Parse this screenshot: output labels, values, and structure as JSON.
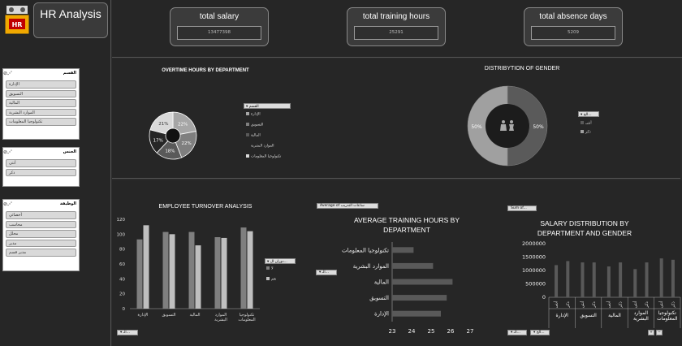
{
  "app": {
    "title": "HR Analysis",
    "logo_text": "HR"
  },
  "kpis": [
    {
      "label": "total salary",
      "value": "13477398"
    },
    {
      "label": "total training hours",
      "value": "25291"
    },
    {
      "label": "total absence days",
      "value": "5209"
    }
  ],
  "slicers": [
    {
      "title": "القسم",
      "items": [
        "الإدارة",
        "التسويق",
        "المالية",
        "الموارد البشرية",
        "تكنولوجيا المعلومات"
      ]
    },
    {
      "title": "الجنس",
      "items": [
        "أنثى",
        "ذكر"
      ]
    },
    {
      "title": "الوظيفة",
      "items": [
        "أخصائي",
        "محاسب",
        "محلل",
        "مدير",
        "مدير قسم"
      ]
    }
  ],
  "overtime": {
    "title": "OVERTIME HOURS BY DEPARTMENT",
    "legend_head": "القسم",
    "legend": [
      "الإدارة",
      "التسويق",
      "المالية",
      "الموارد البشرية",
      "تكنولوجيا المعلومات"
    ],
    "colors": [
      "#a6a6a6",
      "#7f7f7f",
      "#595959",
      "#262626",
      "#d9d9d9"
    ],
    "chart_data": {
      "type": "pie",
      "categories": [
        "الإدارة",
        "التسويق",
        "المالية",
        "الموارد البشرية",
        "تكنولوجيا المعلومات"
      ],
      "values": [
        22,
        22,
        18,
        17,
        21
      ],
      "labels": [
        "22%",
        "22%",
        "18%",
        "17%",
        "21%"
      ]
    }
  },
  "gender": {
    "title": "DISTRIBYTION OF GENDER",
    "legend_head": "الج...",
    "legend": [
      "أنثى",
      "ذكر"
    ],
    "colors": [
      "#5a5a5a",
      "#a0a0a0"
    ],
    "chart_data": {
      "type": "pie",
      "categories": [
        "أنثى",
        "ذكر"
      ],
      "values": [
        50,
        50
      ],
      "labels": [
        "50%",
        "50%"
      ]
    }
  },
  "turnover": {
    "title": "EMPLOYEE TURNOVER ANALYSIS",
    "legend_head": "دوران ال...",
    "legend": [
      "لا",
      "نعم"
    ],
    "colors": [
      "#7f7f7f",
      "#bfbfbf"
    ],
    "filter_label": "الـ...",
    "chart_data": {
      "type": "bar",
      "categories": [
        "الإدارة",
        "التسويق",
        "المالية",
        "الموارد البشرية",
        "تكنولوجيا المعلومات"
      ],
      "series": [
        {
          "name": "لا",
          "values": [
            93,
            103,
            103,
            96,
            109
          ]
        },
        {
          "name": "نعم",
          "values": [
            112,
            100,
            85,
            95,
            104
          ]
        }
      ],
      "ylim": [
        0,
        120
      ],
      "yticks": [
        "0",
        "20",
        "40",
        "60",
        "80",
        "100",
        "120"
      ]
    }
  },
  "training": {
    "title": "AVERAGE TRAINING HOURS BY DEPARTMENT",
    "field_btn": "Average of ساعات التدريب",
    "axis_btn": "الـ...",
    "chart_data": {
      "type": "bar",
      "categories": [
        "الإدارة",
        "التسويق",
        "المالية",
        "الموارد البشرية",
        "تكنولوجيا المعلومات"
      ],
      "values": [
        25.5,
        25.8,
        26.1,
        25.1,
        24.1
      ],
      "xlim": [
        23,
        27
      ],
      "xticks": [
        "23",
        "24",
        "25",
        "26",
        "27"
      ]
    }
  },
  "salary": {
    "title": "SALARY DISTRIBUTION BY DEPARTMENT AND GENDER",
    "field_btn": "Sum of...",
    "axis_btn1": "الـ...",
    "axis_btn2": "الج...",
    "gender_labels": [
      "أنثى",
      "ذكر"
    ],
    "chart_data": {
      "type": "bar",
      "categories": [
        "الإدارة",
        "التسويق",
        "المالية",
        "الموارد البشرية",
        "تكنولوجيا المعلومات"
      ],
      "series": [
        {
          "values": [
            1200000,
            1300000,
            1150000,
            1050000,
            1450000
          ]
        },
        {
          "values": [
            1350000,
            1300000,
            1300000,
            1300000,
            1400000
          ]
        }
      ],
      "ylim": [
        0,
        2000000
      ],
      "yticks": [
        "0",
        "500000",
        "1000000",
        "1500000",
        "2000000"
      ]
    }
  }
}
